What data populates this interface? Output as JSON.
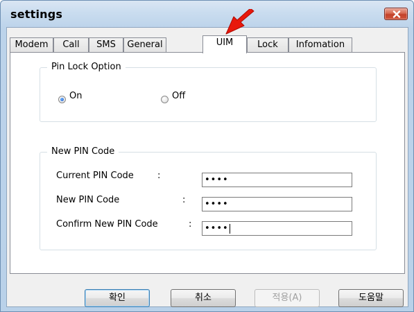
{
  "window": {
    "title": "settings",
    "close_icon": "close-icon"
  },
  "tabs": [
    {
      "label": "Modem",
      "active": false
    },
    {
      "label": "Call",
      "active": false
    },
    {
      "label": "SMS",
      "active": false
    },
    {
      "label": "General",
      "active": false
    },
    {
      "label": "UIM",
      "active": true
    },
    {
      "label": "Lock",
      "active": false
    },
    {
      "label": "Infomation",
      "active": false
    }
  ],
  "pin_lock": {
    "title": "Pin Lock Option",
    "options": [
      {
        "label": "On",
        "checked": true
      },
      {
        "label": "Off",
        "checked": false
      }
    ]
  },
  "new_pin": {
    "title": "New PIN Code",
    "fields": [
      {
        "label": "Current PIN Code",
        "colon": ":",
        "value": "••••"
      },
      {
        "label": "New PIN Code",
        "colon": ":",
        "value": "••••"
      },
      {
        "label": "Confirm New PIN Code",
        "colon": ":",
        "value": "••••"
      }
    ]
  },
  "buttons": {
    "ok": "확인",
    "cancel": "취소",
    "apply": "적용(A)",
    "help": "도움말"
  },
  "colors": {
    "annotation_arrow": "#e8180c",
    "title_bar": "#c9dcef",
    "close_button": "#c3422a"
  }
}
